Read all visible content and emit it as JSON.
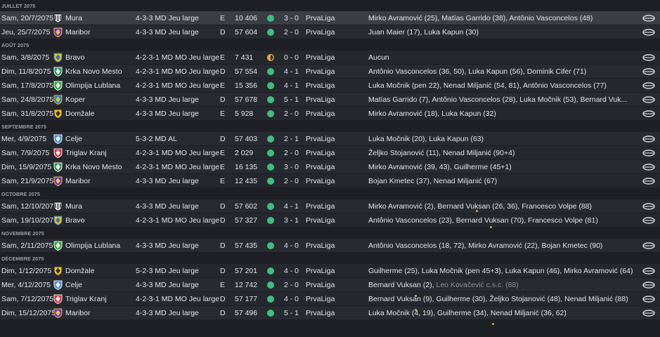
{
  "colors": {
    "win": "#3fbf7f",
    "draw": "#e3a33a",
    "rating_star": "#e0b03a",
    "crest": {
      "mura": [
        "#e8e8e8",
        "#111111"
      ],
      "maribor": [
        "#7b2fb8",
        "#e6c84a"
      ],
      "bravo": [
        "#e6c21e",
        "#2d6fc7"
      ],
      "krka": [
        "#2f9a5a",
        "#f2f2f2"
      ],
      "olimpija": [
        "#2fae3a",
        "#f2f2f2"
      ],
      "koper": [
        "#2b7dcb",
        "#e5c322"
      ],
      "domzale": [
        "#f0c419",
        "#2d2d2d"
      ],
      "celje": [
        "#4c8fd8",
        "#f2f2f2"
      ],
      "triglav": [
        "#d8343a",
        "#f2f2f2"
      ]
    }
  },
  "icons": {
    "result": "match-report-icon",
    "dot": "result-dot-icon",
    "crest": "club-crest-icon"
  },
  "groups": [
    {
      "month": "JUILLET 2075",
      "matches": [
        {
          "date": "Sam, 20/7/2075",
          "crest": "mura",
          "team": "Mura",
          "formation": "4-3-3 MD Jeu large",
          "venue": "E",
          "attendance": "10 406",
          "result": "win",
          "score": "3 - 0",
          "competition": "PrvaLiga",
          "scorers": "Mirko Avramović (25), Matías Garrido (38), Antônio Vasconcelos (48)",
          "highlight": true
        },
        {
          "date": "Jeu, 25/7/2075",
          "crest": "maribor",
          "team": "Maribor",
          "formation": "4-3-3 MD Jeu large",
          "venue": "D",
          "attendance": "57 604",
          "result": "win",
          "score": "2 - 0",
          "competition": "PrvaLiga",
          "scorers": "Juan Maier (17), Luka Kapun (30)"
        }
      ]
    },
    {
      "month": "AOÛT 2075",
      "matches": [
        {
          "date": "Sam, 3/8/2075",
          "crest": "bravo",
          "team": "Bravo",
          "formation": "4-2-3-1 MD MO Jeu large",
          "venue": "E",
          "attendance": "7 431",
          "result": "draw",
          "score": "0 - 0",
          "competition": "PrvaLiga",
          "scorers": "Aucun"
        },
        {
          "date": "Dim, 11/8/2075",
          "crest": "krka",
          "team": "Krka Novo Mesto",
          "formation": "4-2-3-1 MD MO Jeu large",
          "venue": "D",
          "attendance": "57 554",
          "result": "win",
          "score": "4 - 1",
          "competition": "PrvaLiga",
          "scorers": "Antônio Vasconcelos (36, 50), Luka Kapun (56), Dominik Cifer (71)"
        },
        {
          "date": "Sam, 17/8/2075",
          "crest": "olimpija",
          "team": "Olimpija Lublana",
          "formation": "4-2-3-1 MD MO Jeu large",
          "venue": "E",
          "attendance": "15 356",
          "result": "win",
          "score": "4 - 1",
          "competition": "PrvaLiga",
          "scorers": "Luka Močnik (pen 22), Nenad Miljanić (54, 81), Antônio Vasconcelos (77)"
        },
        {
          "date": "Sam, 24/8/2075",
          "crest": "koper",
          "team": "Koper",
          "formation": "4-3-3 MD Jeu large",
          "venue": "D",
          "attendance": "57 678",
          "result": "win",
          "score": "5 - 1",
          "competition": "PrvaLiga",
          "scorers": "Matías Garrido (7), Antônio Vasconcelos (28), Luka Močnik (53), Bernard Vuk..."
        },
        {
          "date": "Sam, 31/8/2075",
          "crest": "domzale",
          "team": "Domžale",
          "formation": "4-3-3 MD Jeu large",
          "venue": "E",
          "attendance": "5 928",
          "result": "win",
          "score": "2 - 0",
          "competition": "PrvaLiga",
          "scorers": "Mirko Avramović (18), Luka Kapun (32)"
        }
      ]
    },
    {
      "month": "SEPTEMBRE 2075",
      "matches": [
        {
          "date": "Mer, 4/9/2075",
          "crest": "celje",
          "team": "Celje",
          "formation": "5-3-2 MD AL",
          "venue": "D",
          "attendance": "57 403",
          "result": "win",
          "score": "2 - 1",
          "competition": "PrvaLiga",
          "scorers": "Luka Močnik (20), Luka Kapun (63)"
        },
        {
          "date": "Sam, 7/9/2075",
          "crest": "triglav",
          "team": "Triglav Kranj",
          "formation": "4-2-3-1 MD MO Jeu large",
          "venue": "E",
          "attendance": "2 029",
          "result": "win",
          "score": "2 - 0",
          "competition": "PrvaLiga",
          "scorers": "Željko Stojanović (11), Nenad Miljanić (90+4)"
        },
        {
          "date": "Dim, 15/9/2075",
          "crest": "krka",
          "team": "Krka Novo Mesto",
          "formation": "4-2-3-1 MD MO Jeu large",
          "venue": "E",
          "attendance": "16 135",
          "result": "win",
          "score": "3 - 0",
          "competition": "PrvaLiga",
          "scorers": "Mirko Avramović (39, 43), Guilherme (45+1)"
        },
        {
          "date": "Sam, 21/9/2075",
          "crest": "maribor",
          "team": "Maribor",
          "formation": "4-3-3 MD Jeu large",
          "venue": "E",
          "attendance": "12 435",
          "result": "win",
          "score": "2 - 0",
          "competition": "PrvaLiga",
          "scorers": "Bojan Kmetec (37), Nenad Miljanić (67)"
        }
      ]
    },
    {
      "month": "OCTOBRE 2075",
      "matches": [
        {
          "date": "Sam, 12/10/2075",
          "crest": "mura",
          "team": "Mura",
          "formation": "4-3-3 MD Jeu large",
          "venue": "D",
          "attendance": "57 602",
          "result": "win",
          "score": "4 - 1",
          "competition": "PrvaLiga",
          "scorers": "Mirko Avramović (2), Bernard Vuksan (26, 36), Francesco Volpe (88)"
        },
        {
          "date": "Sam, 19/10/2075",
          "crest": "bravo",
          "team": "Bravo",
          "formation": "4-2-3-1 MD MO Jeu large",
          "venue": "D",
          "attendance": "57 327",
          "result": "win",
          "score": "3 - 1",
          "competition": "PrvaLiga",
          "scorers": "Antônio Vasconcelos (23), Bernard Vuksan (70), Francesco Volpe (81)"
        }
      ]
    },
    {
      "month": "NOVEMBRE 2075",
      "matches": [
        {
          "date": "Sam, 2/11/2075",
          "crest": "olimpija",
          "team": "Olimpija Lublana",
          "formation": "4-3-3 MD Jeu large",
          "venue": "D",
          "attendance": "57 435",
          "result": "win",
          "score": "4 - 0",
          "competition": "PrvaLiga",
          "scorers": "Antônio Vasconcelos (18, 72), Mirko Avramović (22), Bojan Kmetec (90)"
        }
      ]
    },
    {
      "month": "DÉCEMBRE 2075",
      "matches": [
        {
          "date": "Dim, 1/12/2075",
          "crest": "domzale",
          "team": "Domžale",
          "formation": "5-2-3 MD Jeu large",
          "venue": "D",
          "attendance": "57 201",
          "result": "win",
          "score": "4 - 0",
          "competition": "PrvaLiga",
          "scorers": "Guilherme (25), Luka Močnik (pen 45+3), Luka Kapun (46), Mirko Avramović (64)"
        },
        {
          "date": "Mer, 4/12/2075",
          "crest": "celje",
          "team": "Celje",
          "formation": "4-3-3 MD Jeu large",
          "venue": "E",
          "attendance": "12 742",
          "result": "win",
          "score": "2 - 0",
          "competition": "PrvaLiga",
          "scorers": "Bernard Vuksan (2),",
          "scorers_og": "Leo Kovačević c.s.c. (88)"
        },
        {
          "date": "Sam, 7/12/2075",
          "crest": "triglav",
          "team": "Triglav Kranj",
          "formation": "4-2-3-1 MD MO Jeu large",
          "venue": "D",
          "attendance": "57 177",
          "result": "win",
          "score": "4 - 0",
          "competition": "PrvaLiga",
          "scorers": "Bernard Vuksan (9), Guilherme (30), Željko Stojanović (48), Nenad Miljanić (88)"
        },
        {
          "date": "Dim, 15/12/2075",
          "crest": "maribor",
          "team": "Maribor",
          "formation": "4-3-3 MD Jeu large",
          "venue": "D",
          "attendance": "57 496",
          "result": "win",
          "score": "5 - 1",
          "competition": "PrvaLiga",
          "scorers": "Luka Močnik (4, 19), Guilherme (34), Nenad Miljanić (36, 62)"
        }
      ]
    }
  ]
}
